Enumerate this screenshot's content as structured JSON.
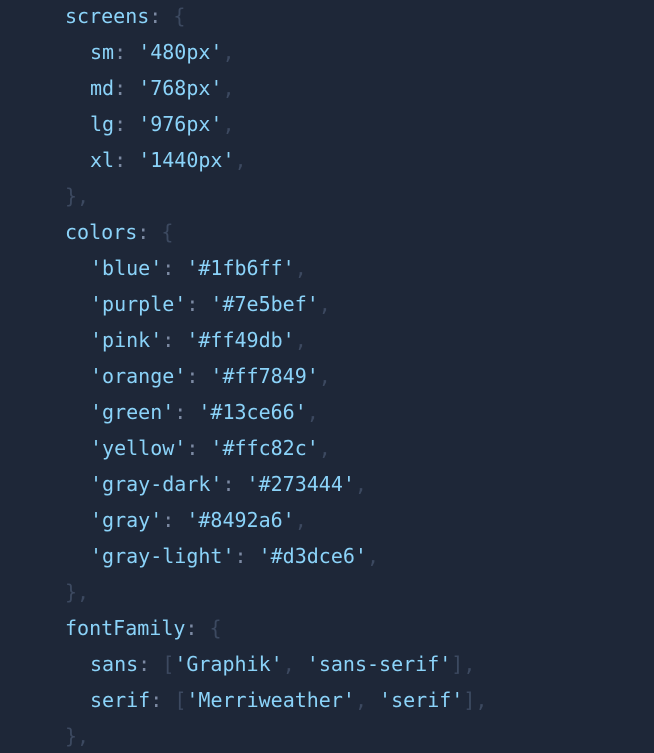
{
  "code": {
    "lines": [
      {
        "indent": 0,
        "key": "screens",
        "open": "{"
      },
      {
        "indent": 1,
        "key": "sm",
        "value": "'480px'"
      },
      {
        "indent": 1,
        "key": "md",
        "value": "'768px'"
      },
      {
        "indent": 1,
        "key": "lg",
        "value": "'976px'"
      },
      {
        "indent": 1,
        "key": "xl",
        "value": "'1440px'"
      },
      {
        "indent": 0,
        "close": "},"
      },
      {
        "indent": 0,
        "key": "colors",
        "open": "{"
      },
      {
        "indent": 1,
        "key": "'blue'",
        "value": "'#1fb6ff'"
      },
      {
        "indent": 1,
        "key": "'purple'",
        "value": "'#7e5bef'"
      },
      {
        "indent": 1,
        "key": "'pink'",
        "value": "'#ff49db'"
      },
      {
        "indent": 1,
        "key": "'orange'",
        "value": "'#ff7849'"
      },
      {
        "indent": 1,
        "key": "'green'",
        "value": "'#13ce66'"
      },
      {
        "indent": 1,
        "key": "'yellow'",
        "value": "'#ffc82c'"
      },
      {
        "indent": 1,
        "key": "'gray-dark'",
        "value": "'#273444'"
      },
      {
        "indent": 1,
        "key": "'gray'",
        "value": "'#8492a6'"
      },
      {
        "indent": 1,
        "key": "'gray-light'",
        "value": "'#d3dce6'"
      },
      {
        "indent": 0,
        "close": "},"
      },
      {
        "indent": 0,
        "key": "fontFamily",
        "open": "{"
      },
      {
        "indent": 1,
        "key": "sans",
        "array": [
          "'Graphik'",
          "'sans-serif'"
        ]
      },
      {
        "indent": 1,
        "key": "serif",
        "array": [
          "'Merriweather'",
          "'serif'"
        ]
      },
      {
        "indent": 0,
        "close": "},"
      }
    ]
  },
  "colors": {
    "background": "#1e2738",
    "token": "#8bd3f9",
    "punctuation": "#3c4960",
    "colon": "#7c8aa3"
  }
}
